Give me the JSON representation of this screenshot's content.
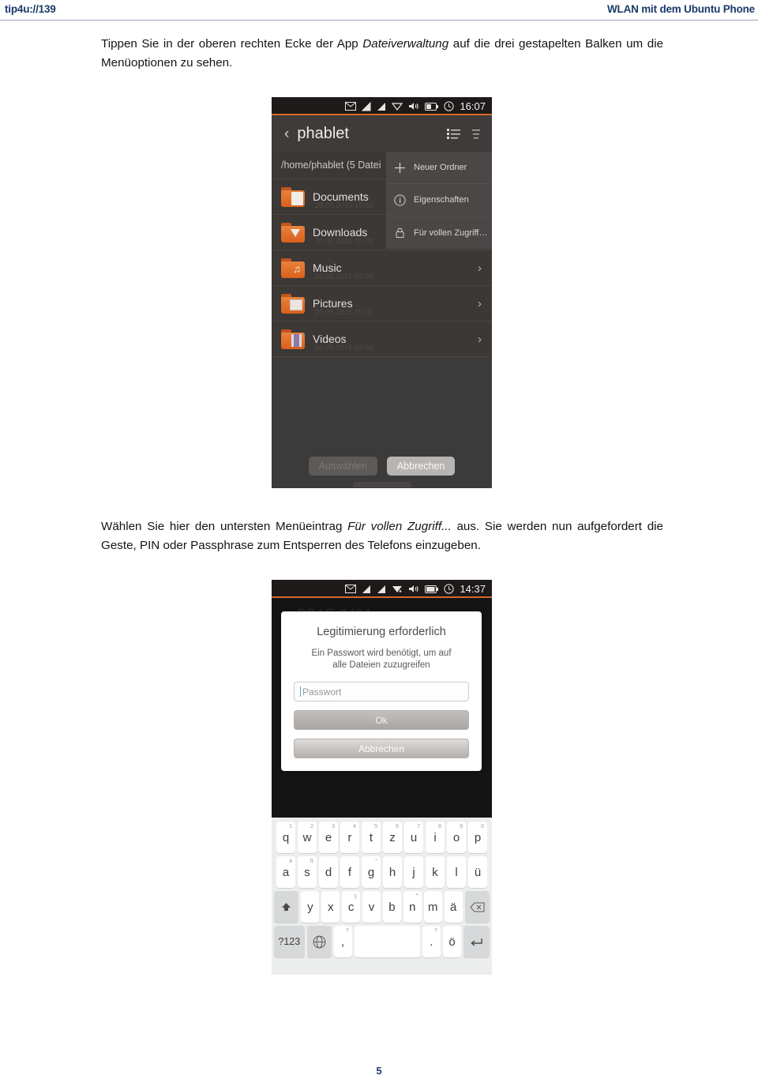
{
  "header": {
    "left": "tip4u://139",
    "right": "WLAN mit dem Ubuntu Phone",
    "accent_color": "#1b3a6b"
  },
  "paragraphs": {
    "p1_part1": "Tippen Sie in der oberen rechten Ecke der App ",
    "p1_italic": "Dateiverwaltung",
    "p1_part2": " auf die drei gestapelten Balken um die Menüoptionen zu sehen.",
    "p2_part1": "Wählen Sie hier den untersten Menüeintrag ",
    "p2_italic": "Für vollen Zugriff...",
    "p2_part2": " aus. Sie werden nun aufgefordert die Geste, PIN oder Passphrase zum Entsperren des Telefons einzugeben."
  },
  "page_number": "5",
  "screenshot_files": {
    "statusbar": {
      "time": "16:07",
      "icons": [
        "mail-icon",
        "signal-icon",
        "signal-icon",
        "wifi-icon",
        "volume-icon",
        "battery-icon",
        "clock-icon"
      ]
    },
    "appbar": {
      "back": "‹",
      "title": "phablet",
      "actions": [
        "list-view-icon",
        "overflow-menu-icon"
      ]
    },
    "path_label": "/home/phablet (5 Datei",
    "files": [
      {
        "name": "Documents",
        "sub": "20.05.2015 15:02",
        "icon": "folder-documents-icon"
      },
      {
        "name": "Downloads",
        "sub": "20.05.2015 15:03",
        "icon": "folder-downloads-icon"
      },
      {
        "name": "Music",
        "sub": "20.05.2015 15:02",
        "icon": "folder-music-icon"
      },
      {
        "name": "Pictures",
        "sub": "20.05.2015 15:02",
        "icon": "folder-pictures-icon"
      },
      {
        "name": "Videos",
        "sub": "20.05.2015 15:02",
        "icon": "folder-videos-icon"
      }
    ],
    "menu": [
      {
        "label": "Neuer Ordner",
        "icon": "plus-icon"
      },
      {
        "label": "Eigenschaften",
        "icon": "info-icon"
      },
      {
        "label": "Für vollen Zugriff…",
        "icon": "lock-icon"
      }
    ],
    "buttons": {
      "select": "Auswählen",
      "cancel": "Abbrechen"
    }
  },
  "screenshot_auth": {
    "statusbar": {
      "time": "14:37",
      "icons": [
        "mail-icon",
        "signal-icon",
        "signal-icon",
        "wifi-icon",
        "volume-icon",
        "battery-icon",
        "clock-icon"
      ]
    },
    "ghost_title": "BBAE-9464",
    "dialog": {
      "title": "Legitimierung erforderlich",
      "subtitle_line1": "Ein Passwort wird benötigt, um auf",
      "subtitle_line2": "alle Dateien zuzugreifen",
      "input_placeholder": "Passwort",
      "input_value": "",
      "ok_label": "Ok",
      "cancel_label": "Abbrechen"
    },
    "keyboard": {
      "row1": [
        {
          "key": "q",
          "sup": "1"
        },
        {
          "key": "w",
          "sup": "2"
        },
        {
          "key": "e",
          "sup": "3"
        },
        {
          "key": "r",
          "sup": "4"
        },
        {
          "key": "t",
          "sup": "5"
        },
        {
          "key": "z",
          "sup": "6"
        },
        {
          "key": "u",
          "sup": "7"
        },
        {
          "key": "i",
          "sup": "8"
        },
        {
          "key": "o",
          "sup": "9"
        },
        {
          "key": "p",
          "sup": "0"
        }
      ],
      "row2": [
        {
          "key": "a",
          "sup": "à"
        },
        {
          "key": "s",
          "sup": "ß"
        },
        {
          "key": "d",
          "sup": ""
        },
        {
          "key": "f",
          "sup": ""
        },
        {
          "key": "g",
          "sup": "°"
        },
        {
          "key": "h",
          "sup": ""
        },
        {
          "key": "j",
          "sup": ""
        },
        {
          "key": "k",
          "sup": ""
        },
        {
          "key": "l",
          "sup": ""
        },
        {
          "key": "ü",
          "sup": ""
        }
      ],
      "row3": [
        {
          "key": "y",
          "sup": "´"
        },
        {
          "key": "x",
          "sup": ""
        },
        {
          "key": "c",
          "sup": "ç"
        },
        {
          "key": "v",
          "sup": ""
        },
        {
          "key": "b",
          "sup": ""
        },
        {
          "key": "n",
          "sup": "^"
        },
        {
          "key": "m",
          "sup": ""
        },
        {
          "key": "ä",
          "sup": ""
        }
      ],
      "shift": "shift-icon",
      "backspace": "backspace-icon",
      "numeric": "?123",
      "globe": "globe-icon",
      "comma": ",",
      "space": "",
      "period": ".",
      "period_sup": "?",
      "umlaut": "ö",
      "enter": "enter-icon"
    }
  }
}
